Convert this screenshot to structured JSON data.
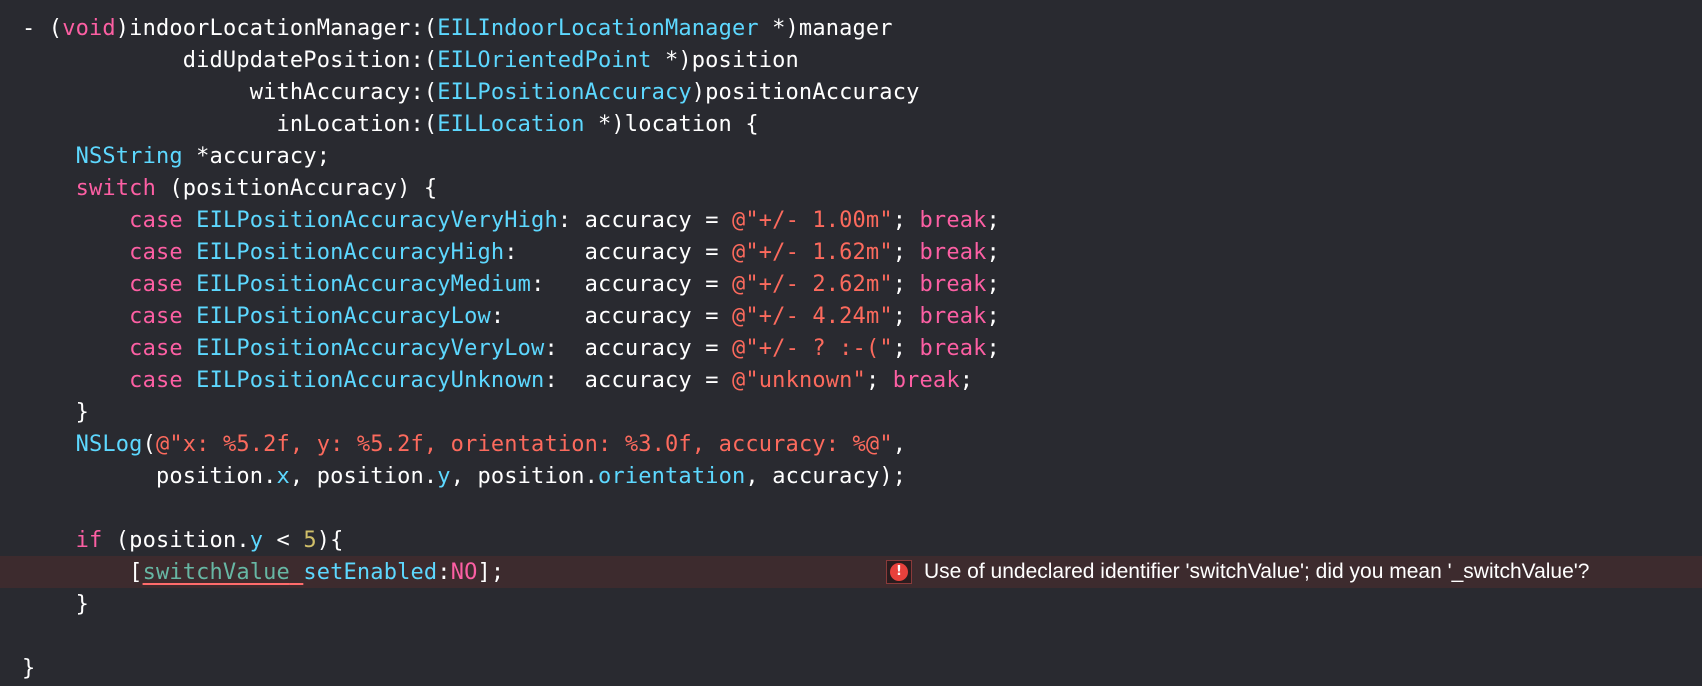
{
  "colors": {
    "background": "#292a30",
    "text": "#ffffff",
    "keyword": "#fc5fa3",
    "type": "#5dd8ff",
    "string": "#fc6a5d",
    "number": "#d0bf69",
    "variable": "#67b7a4",
    "error_line": "#3d2b2e",
    "error_icon": "#e8413c"
  },
  "code_lines": [
    [
      [
        "default",
        "- ("
      ],
      [
        "keyword",
        "void"
      ],
      [
        "default",
        ")indoorLocationManager:("
      ],
      [
        "type",
        "EILIndoorLocationManager"
      ],
      [
        "default",
        " *)manager"
      ]
    ],
    [
      [
        "default",
        "            didUpdatePosition:("
      ],
      [
        "type",
        "EILOrientedPoint"
      ],
      [
        "default",
        " *)position"
      ]
    ],
    [
      [
        "default",
        "                 withAccuracy:("
      ],
      [
        "type",
        "EILPositionAccuracy"
      ],
      [
        "default",
        ")positionAccuracy"
      ]
    ],
    [
      [
        "default",
        "                   inLocation:("
      ],
      [
        "type",
        "EILLocation"
      ],
      [
        "default",
        " *)location {"
      ]
    ],
    [
      [
        "default",
        "    "
      ],
      [
        "type",
        "NSString"
      ],
      [
        "default",
        " *accuracy;"
      ]
    ],
    [
      [
        "default",
        "    "
      ],
      [
        "keyword",
        "switch"
      ],
      [
        "default",
        " (positionAccuracy) {"
      ]
    ],
    [
      [
        "default",
        "        "
      ],
      [
        "keyword",
        "case"
      ],
      [
        "default",
        " "
      ],
      [
        "type",
        "EILPositionAccuracyVeryHigh"
      ],
      [
        "default",
        ": accuracy = "
      ],
      [
        "string",
        "@\"+/- 1.00m\""
      ],
      [
        "default",
        "; "
      ],
      [
        "keyword",
        "break"
      ],
      [
        "default",
        ";"
      ]
    ],
    [
      [
        "default",
        "        "
      ],
      [
        "keyword",
        "case"
      ],
      [
        "default",
        " "
      ],
      [
        "type",
        "EILPositionAccuracyHigh"
      ],
      [
        "default",
        ":     accuracy = "
      ],
      [
        "string",
        "@\"+/- 1.62m\""
      ],
      [
        "default",
        "; "
      ],
      [
        "keyword",
        "break"
      ],
      [
        "default",
        ";"
      ]
    ],
    [
      [
        "default",
        "        "
      ],
      [
        "keyword",
        "case"
      ],
      [
        "default",
        " "
      ],
      [
        "type",
        "EILPositionAccuracyMedium"
      ],
      [
        "default",
        ":   accuracy = "
      ],
      [
        "string",
        "@\"+/- 2.62m\""
      ],
      [
        "default",
        "; "
      ],
      [
        "keyword",
        "break"
      ],
      [
        "default",
        ";"
      ]
    ],
    [
      [
        "default",
        "        "
      ],
      [
        "keyword",
        "case"
      ],
      [
        "default",
        " "
      ],
      [
        "type",
        "EILPositionAccuracyLow"
      ],
      [
        "default",
        ":      accuracy = "
      ],
      [
        "string",
        "@\"+/- 4.24m\""
      ],
      [
        "default",
        "; "
      ],
      [
        "keyword",
        "break"
      ],
      [
        "default",
        ";"
      ]
    ],
    [
      [
        "default",
        "        "
      ],
      [
        "keyword",
        "case"
      ],
      [
        "default",
        " "
      ],
      [
        "type",
        "EILPositionAccuracyVeryLow"
      ],
      [
        "default",
        ":  accuracy = "
      ],
      [
        "string",
        "@\"+/- ? :-(\""
      ],
      [
        "default",
        "; "
      ],
      [
        "keyword",
        "break"
      ],
      [
        "default",
        ";"
      ]
    ],
    [
      [
        "default",
        "        "
      ],
      [
        "keyword",
        "case"
      ],
      [
        "default",
        " "
      ],
      [
        "type",
        "EILPositionAccuracyUnknown"
      ],
      [
        "default",
        ":  accuracy = "
      ],
      [
        "string",
        "@\"unknown\""
      ],
      [
        "default",
        "; "
      ],
      [
        "keyword",
        "break"
      ],
      [
        "default",
        ";"
      ]
    ],
    [
      [
        "default",
        "    }"
      ]
    ],
    [
      [
        "default",
        "    "
      ],
      [
        "type",
        "NSLog"
      ],
      [
        "default",
        "("
      ],
      [
        "string",
        "@\"x: %5.2f, y: %5.2f, orientation: %3.0f, accuracy: %@\""
      ],
      [
        "default",
        ","
      ]
    ],
    [
      [
        "default",
        "          position."
      ],
      [
        "type",
        "x"
      ],
      [
        "default",
        ", position."
      ],
      [
        "type",
        "y"
      ],
      [
        "default",
        ", position."
      ],
      [
        "type",
        "orientation"
      ],
      [
        "default",
        ", accuracy);"
      ]
    ],
    [],
    [
      [
        "default",
        "    "
      ],
      [
        "keyword",
        "if"
      ],
      [
        "default",
        " (position."
      ],
      [
        "type",
        "y"
      ],
      [
        "default",
        " < "
      ],
      [
        "number",
        "5"
      ],
      [
        "default",
        "){"
      ]
    ],
    [
      [
        "default",
        "        ["
      ],
      [
        "variable_err",
        "switchValue"
      ],
      [
        "variable_err",
        " "
      ],
      [
        "type",
        "setEnabled"
      ],
      [
        "default",
        ":"
      ],
      [
        "keyword",
        "NO"
      ],
      [
        "default",
        "];"
      ]
    ],
    [
      [
        "default",
        "    }"
      ]
    ],
    [],
    [
      [
        "default",
        "}"
      ]
    ]
  ],
  "error": {
    "icon": "exclamation-icon",
    "icon_glyph": "!",
    "message": "Use of undeclared identifier 'switchValue'; did you mean '_switchValue'?"
  }
}
